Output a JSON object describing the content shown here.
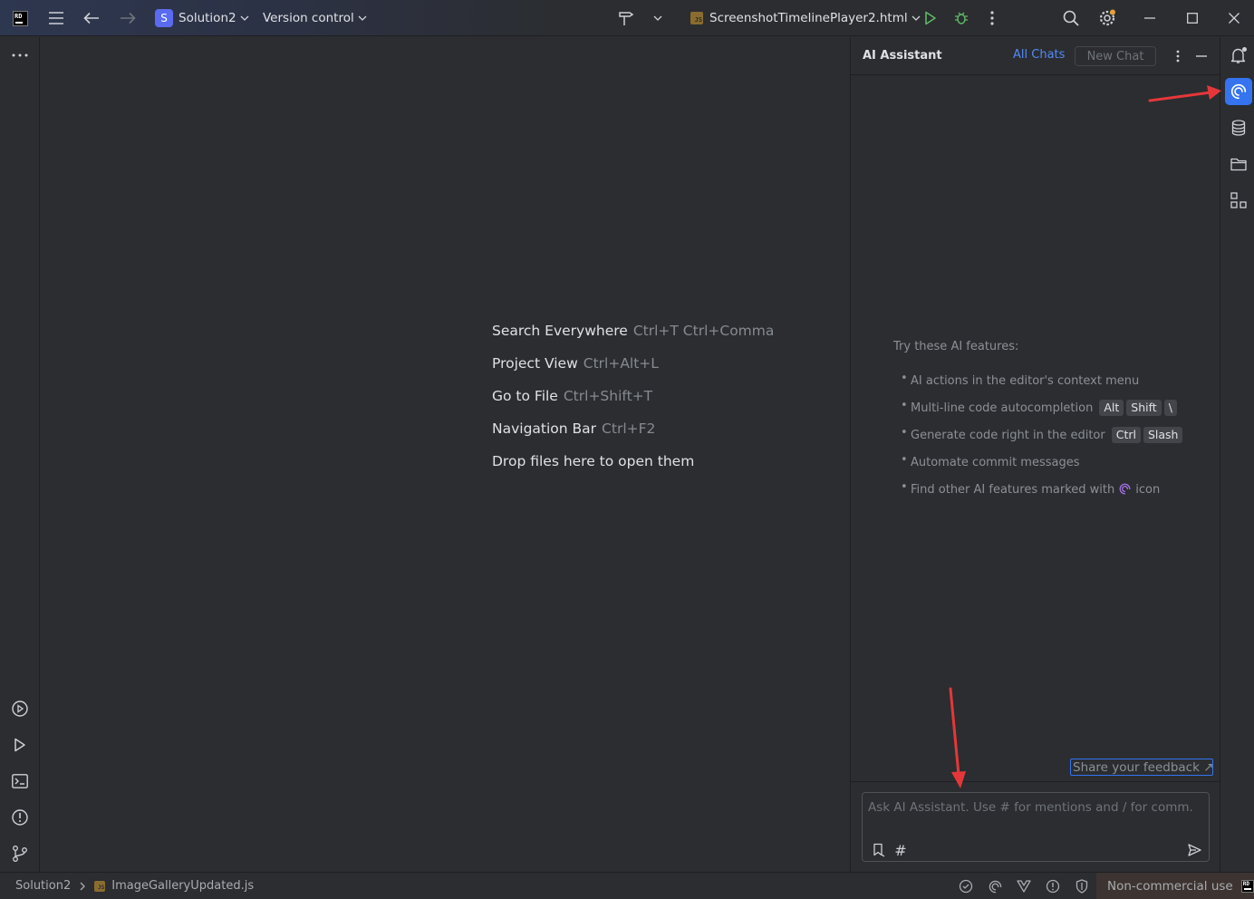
{
  "titlebar": {
    "project_initial": "S",
    "project_name": "Solution2",
    "version_control": "Version control",
    "run_config": "ScreenshotTimelinePlayer2.html",
    "run_config_badge": "JS",
    "logo_text": "RD"
  },
  "editor": {
    "hints": [
      {
        "label": "Search Everywhere",
        "shortcut": "Ctrl+T Ctrl+Comma"
      },
      {
        "label": "Project View",
        "shortcut": "Ctrl+Alt+L"
      },
      {
        "label": "Go to File",
        "shortcut": "Ctrl+Shift+T"
      },
      {
        "label": "Navigation Bar",
        "shortcut": "Ctrl+F2"
      },
      {
        "label": "Drop files here to open them",
        "shortcut": ""
      }
    ]
  },
  "ai_panel": {
    "title": "AI Assistant",
    "all_chats": "All Chats",
    "new_chat": "New Chat",
    "features_title": "Try these AI features:",
    "features": {
      "f1": "AI actions in the editor's context menu",
      "f2": "Multi-line code autocompletion",
      "f2_keys": [
        "Alt",
        "Shift",
        "\\"
      ],
      "f3": "Generate code right in the editor",
      "f3_keys": [
        "Ctrl",
        "Slash"
      ],
      "f4": "Automate commit messages",
      "f5_before": "Find other AI features marked with",
      "f5_after": "icon"
    },
    "feedback": "Share your feedback ↗",
    "composer_placeholder": "Ask AI Assistant. Use # for mentions and / for comm...",
    "hash_symbol": "#"
  },
  "statusbar": {
    "breadcrumb_project": "Solution2",
    "breadcrumb_file": "ImageGalleryUpdated.js",
    "license": "Non-commercial use"
  },
  "colors": {
    "background": "#2b2d30",
    "accent_blue": "#3574f0",
    "link_blue": "#548af7",
    "run_green": "#5fb865",
    "annotation_red": "#e5373a",
    "ai_purple": "#a571e6"
  },
  "icons": {
    "titlebar": [
      "app-logo-icon",
      "main-menu-icon",
      "back-arrow-icon",
      "forward-arrow-icon",
      "hammer-build-icon",
      "run-icon",
      "debug-bug-icon",
      "search-icon",
      "settings-gear-icon"
    ],
    "left_strip": [
      "more-dots-icon",
      "services-icon",
      "run-tool-icon",
      "terminal-icon",
      "problems-icon",
      "git-icon"
    ],
    "right_strip": [
      "notifications-bell-icon",
      "ai-assistant-spiral-icon",
      "database-icon",
      "folder-icon",
      "structure-icon"
    ]
  }
}
